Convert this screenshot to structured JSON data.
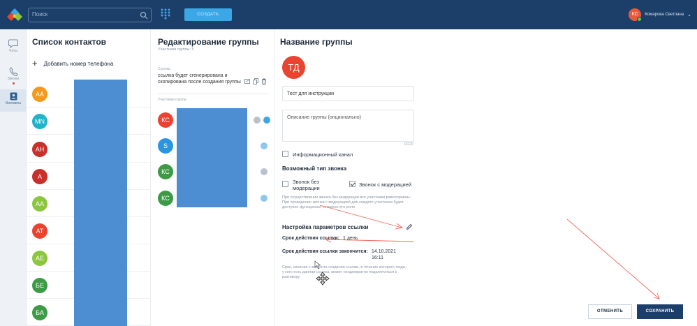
{
  "header": {
    "search_placeholder": "Поиск",
    "create_label": "СОЗДАТЬ",
    "user_initials": "КС",
    "user_name": "Комарова Светлана"
  },
  "rail": {
    "items": [
      {
        "label": "Чаты"
      },
      {
        "label": "Звонки"
      },
      {
        "label": "Контакты"
      }
    ]
  },
  "contacts": {
    "title": "Список контактов",
    "add_phone": "Добавить номер телефона",
    "items": [
      {
        "initials": "AA",
        "color": "#f39a1e"
      },
      {
        "initials": "MN",
        "color": "#21b3c9"
      },
      {
        "initials": "AH",
        "color": "#c9302c"
      },
      {
        "initials": "A",
        "color": "#c9302c"
      },
      {
        "initials": "AA",
        "color": "#8cc63f"
      },
      {
        "initials": "AT",
        "color": "#e8442f"
      },
      {
        "initials": "AE",
        "color": "#8cc63f"
      },
      {
        "initials": "БЕ",
        "color": "#3e9b45"
      },
      {
        "initials": "БА",
        "color": "#3e9b45"
      }
    ]
  },
  "group_edit": {
    "title": "Редактирование группы",
    "subtitle": "Участники группы: 5",
    "ref_label": "Ссылка",
    "ref_text": "ссылка будет сгенерирована и скопирована после создания группы",
    "members_label": "Участники группы",
    "members": [
      {
        "initials": "КС",
        "color": "#e8442f"
      },
      {
        "initials": "S",
        "color": "#2b95e0"
      },
      {
        "initials": "КС",
        "color": "#3e9b45"
      },
      {
        "initials": "КС",
        "color": "#3e9b45"
      }
    ]
  },
  "group_name": {
    "title": "Название группы",
    "avatar": "ТД",
    "name_value": "Тест для инструкции",
    "description_placeholder": "Описание группы (опционально)",
    "counter": "0/220",
    "info_channel": "Информационный канал",
    "call_type_title": "Возможный тип звонка",
    "no_moderation": "Звонок без модерации",
    "with_moderation": "Звонок с модерацией",
    "moderation_hint": "При осуществлении звонка без модерации все участники равноправны. При проведении звонка с модерацией для каждого участника будет доступен функционал согласно его роли",
    "link_settings_title": "Настройка параметров ссылки",
    "link_duration_label": "Срок действия ссылки:",
    "link_duration_value": "1 день",
    "link_end_label": "Срок действия ссылки закончится:",
    "link_end_date": "14.10.2021",
    "link_end_time": "16:11",
    "link_hint": "Срок, начиная с момента создания ссылки, в течение которого люди, у кого есть данная ссылка, может неоднократно подключаться к разговору"
  },
  "footer": {
    "cancel": "ОТМЕНИТЬ",
    "save": "СОХРАНИТЬ"
  },
  "colors": {
    "header_bg": "#1c3f6a",
    "accent": "#3ba7e6",
    "annotation": "#f26a5f"
  }
}
